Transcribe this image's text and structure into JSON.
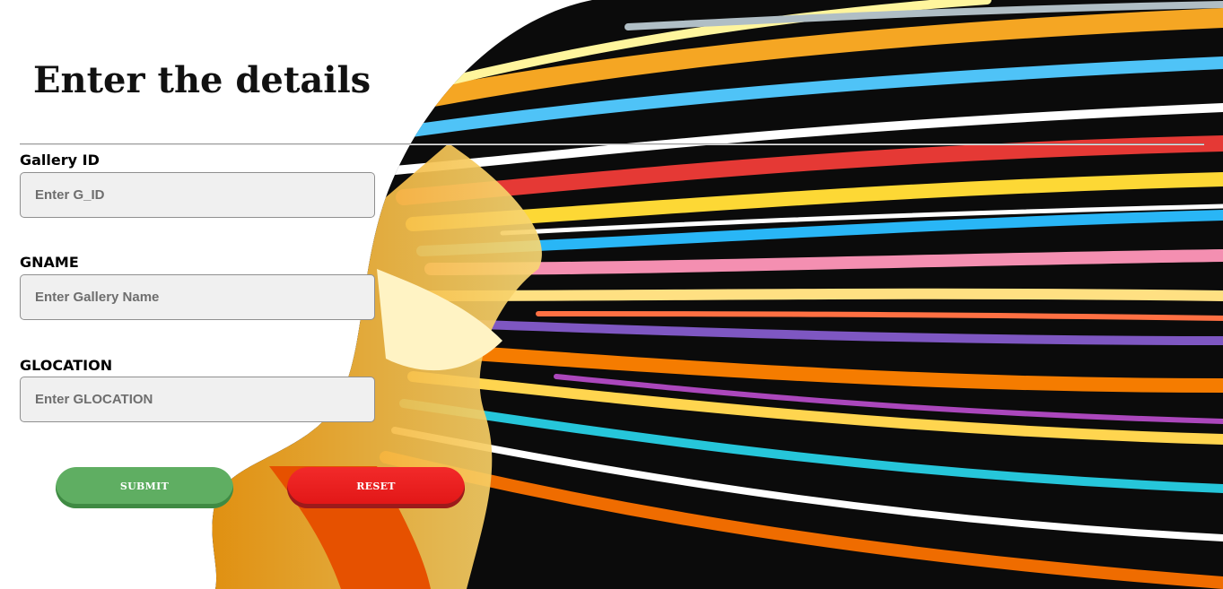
{
  "page": {
    "title": "Enter the details"
  },
  "form": {
    "fields": [
      {
        "label": "Gallery ID",
        "placeholder": "Enter G_ID",
        "value": ""
      },
      {
        "label": "GNAME",
        "placeholder": "Enter Gallery Name",
        "value": ""
      },
      {
        "label": "GLOCATION",
        "placeholder": "Enter GLOCATION",
        "value": ""
      }
    ],
    "buttons": {
      "submit_label": "SUBMIT",
      "reset_label": "RESET"
    }
  },
  "colors": {
    "background": "#ffffff",
    "input_bg": "#f0f0f0",
    "submit": "#5fae62",
    "reset": "#e01515",
    "divider": "#9a9a9a"
  },
  "icons": [
    "abstract-face-artwork"
  ]
}
